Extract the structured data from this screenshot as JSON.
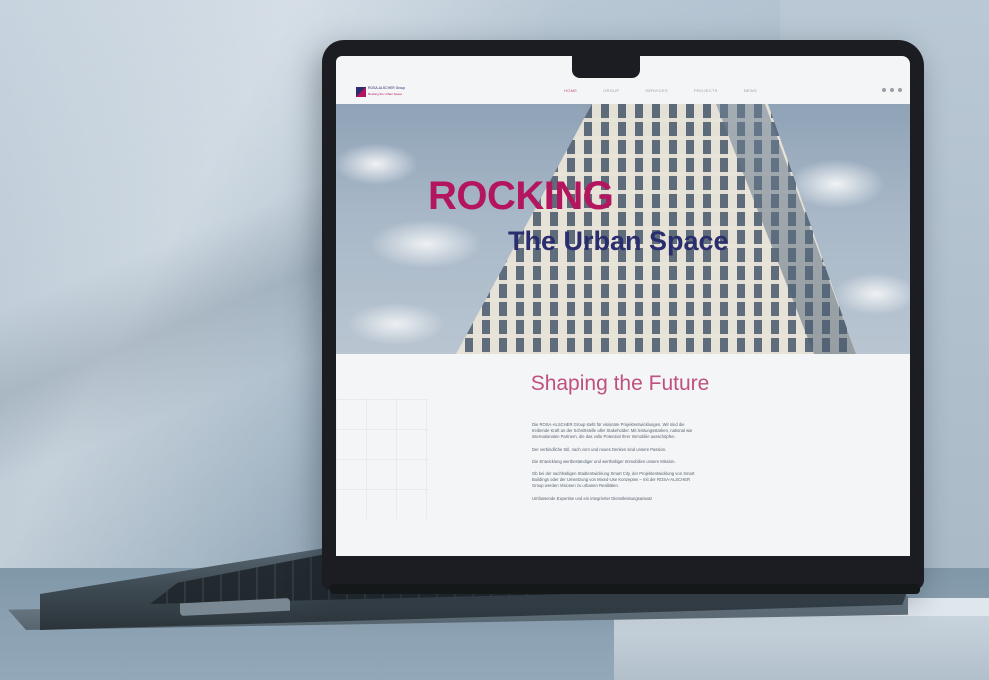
{
  "website": {
    "logo": {
      "name": "ROSA-ALSCHER Group",
      "tagline": "Rocking the Urban Space"
    },
    "nav": {
      "items": [
        "HOME",
        "GROUP",
        "SERVICES",
        "PROJECTS",
        "NEWS"
      ],
      "active": "HOME"
    },
    "hero": {
      "title_line1": "ROCKING",
      "title_line2": "The Urban Space"
    },
    "section": {
      "title": "Shaping the Future",
      "paragraphs": [
        "Die ROSA-ALSCHER Group steht für visionäre Projektentwicklungen. Wir sind die treibende Kraft an der Schnittstelle aller Stakeholder. Mit leistungsstarken, national wie internationalen Partnern, die das volle Potenzial Ihrer Immobilie ausschöpfen.",
        "Der verbindliche Stil, nach vorn und neues Denken sind unsere Passion.",
        "Die Entwicklung wertbeständiger und werthaltiger Immobilien unsere Mission.",
        "Ob bei der nachhaltigen Stadtentwicklung Smart City, der Projektentwicklung von Smart Buildings oder der Umsetzung von Mixed-Use Konzepten – mit der ROSA-ALSCHER Group werden Visionen zu urbanen Realitäten.",
        "Umfassende Expertise und ein integrierter Dienstleistungsansatz"
      ]
    }
  },
  "colors": {
    "brand_magenta": "#b3165f",
    "brand_navy": "#2b2e6e",
    "accent_pink": "#c0507f"
  }
}
